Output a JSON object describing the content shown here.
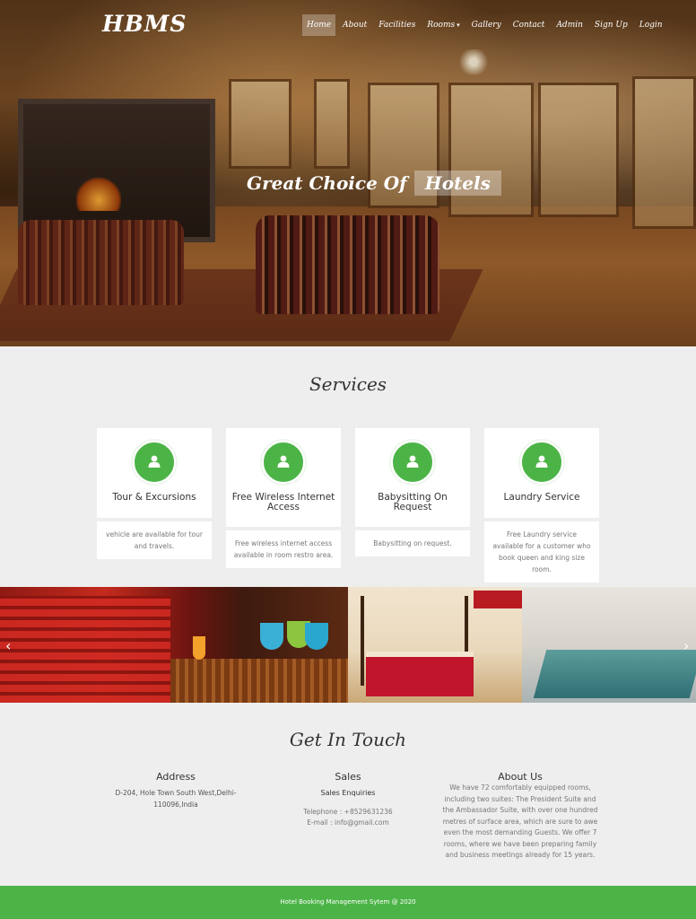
{
  "brand": "HBMS",
  "nav": [
    {
      "label": "Home",
      "active": true
    },
    {
      "label": "About"
    },
    {
      "label": "Facilities"
    },
    {
      "label": "Rooms",
      "dropdown": true
    },
    {
      "label": "Gallery"
    },
    {
      "label": "Contact"
    },
    {
      "label": "Admin"
    },
    {
      "label": "Sign Up"
    },
    {
      "label": "Login"
    }
  ],
  "hero": {
    "headline_part1": "Great Choice Of",
    "headline_part2": "Hotels"
  },
  "services": {
    "title": "Services",
    "items": [
      {
        "icon": "user-icon",
        "title": "Tour & Excursions",
        "desc": "vehicle are available for tour and travels."
      },
      {
        "icon": "user-icon",
        "title": "Free Wireless Internet Access",
        "desc": "Free wireless internet access available in room restro area."
      },
      {
        "icon": "user-icon",
        "title": "Babysitting On Request",
        "desc": "Babysitting on request."
      },
      {
        "icon": "user-icon",
        "title": "Laundry Service",
        "desc": "Free Laundry service available for a customer who book queen and king size room."
      }
    ]
  },
  "gallery": {
    "prev": "‹",
    "next": "›"
  },
  "contact": {
    "title": "Get In Touch",
    "address": {
      "heading": "Address",
      "text": "D-204, Hole Town South West,Delhi-110096,India"
    },
    "sales": {
      "heading": "Sales",
      "sub": "Sales Enquiries",
      "telephone": "Telephone : +8529631236",
      "email": "E-mail : info@gmail.com"
    },
    "about": {
      "heading": "About Us",
      "text": "We have 72 comfortably equipped rooms, including two suites: The President Suite and the Ambassador Suite, with over one hundred metres of surface area, which are sure to awe even the most demanding Guests. We offer 7 rooms, where we have been preparing family and business meetings already for 15 years."
    }
  },
  "footer": "Hotel Booking Management Sytem @ 2020",
  "colors": {
    "accent": "#4cb447",
    "background": "#eeeeee"
  }
}
